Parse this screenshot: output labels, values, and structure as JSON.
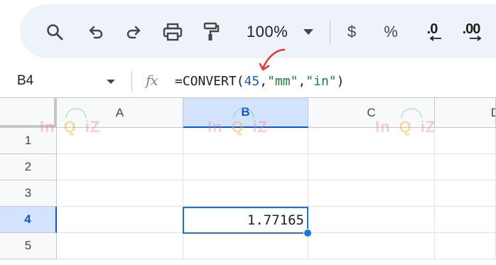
{
  "toolbar": {
    "zoom": "100%",
    "currency_label": "$",
    "percent_label": "%",
    "decrease_decimals_label": ".0",
    "increase_decimals_label": ".00"
  },
  "formula_bar": {
    "cell_ref": "B4",
    "fx_label": "fx",
    "formula_prefix": "=CONVERT(",
    "formula_number": "45",
    "formula_sep1": ",",
    "formula_from": "\"mm\"",
    "formula_sep2": ",",
    "formula_to": "\"in\"",
    "formula_suffix": ")"
  },
  "grid": {
    "columns": [
      "A",
      "B",
      "C",
      "D"
    ],
    "rows": [
      "1",
      "2",
      "3",
      "4",
      "5"
    ],
    "selected_column": "B",
    "selected_row": "4",
    "active_cell_value": "1.77165"
  },
  "watermark": {
    "left": "In",
    "middle": "Q",
    "right": "iZ"
  },
  "colors": {
    "accent": "#1a73e8",
    "selected_header_bg": "#d3e3fd",
    "toolbar_bg": "#eef2f9",
    "annotation_arrow": "#e53935"
  }
}
